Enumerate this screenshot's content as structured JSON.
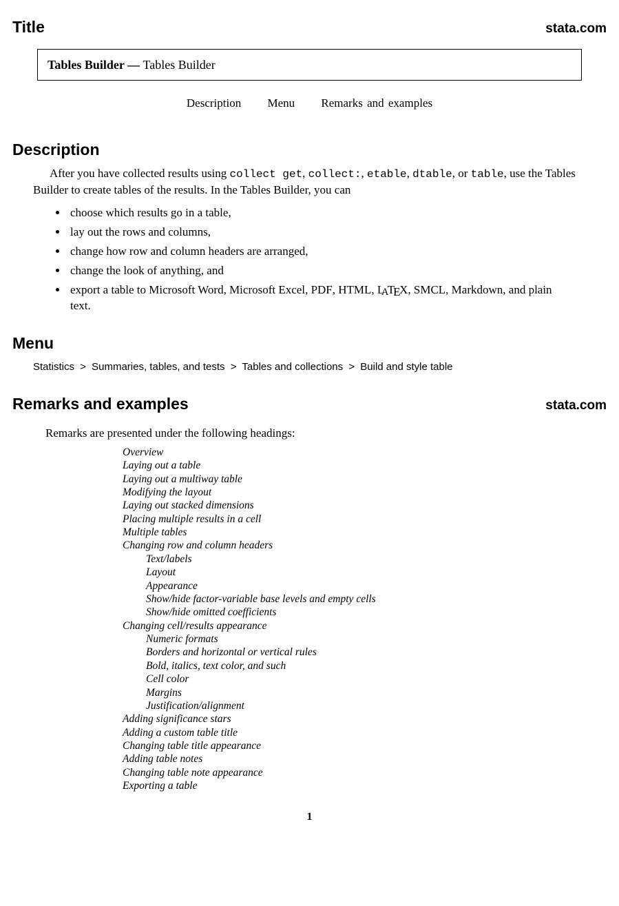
{
  "brand": "stata.com",
  "sections": {
    "title": "Title",
    "description": "Description",
    "menu": "Menu",
    "remarks": "Remarks and examples"
  },
  "title_box": {
    "name": "Tables Builder",
    "dash": " — ",
    "desc": "Tables Builder"
  },
  "nav": {
    "a": "Description",
    "b": "Menu",
    "c": "Remarks and examples"
  },
  "desc_para": {
    "pre": "After you have collected results using ",
    "cmds": [
      "collect get",
      "collect:",
      "etable",
      "dtable",
      "table"
    ],
    "post": ", use the Tables Builder to create tables of the results. In the Tables Builder, you can"
  },
  "bullets": {
    "b1": "choose which results go in a table,",
    "b2": "lay out the rows and columns,",
    "b3": "change how row and column headers are arranged,",
    "b4": "change the look of anything, and",
    "b5_pre": "export a table to Microsoft Word, Microsoft Excel, ",
    "b5_pdf": "PDF",
    "b5_s1": ", ",
    "b5_html": "HTML",
    "b5_s2": ", ",
    "b5_latex": "LATEX",
    "b5_s3": ", ",
    "b5_smcl": "SMCL",
    "b5_post": ", Markdown, and plain text."
  },
  "menu_path": {
    "a": "Statistics",
    "b": "Summaries, tables, and tests",
    "c": "Tables and collections",
    "d": "Build and style table",
    "sep": ">"
  },
  "remarks_intro": "Remarks are presented under the following headings:",
  "toc": {
    "i1": "Overview",
    "i2": "Laying out a table",
    "i3": "Laying out a multiway table",
    "i4": "Modifying the layout",
    "i5": "Laying out stacked dimensions",
    "i6": "Placing multiple results in a cell",
    "i7": "Multiple tables",
    "i8": "Changing row and column headers",
    "i8a": "Text/labels",
    "i8b": "Layout",
    "i8c": "Appearance",
    "i8d": "Show/hide factor-variable base levels and empty cells",
    "i8e": "Show/hide omitted coefficients",
    "i9": "Changing cell/results appearance",
    "i9a": "Numeric formats",
    "i9b": "Borders and horizontal or vertical rules",
    "i9c": "Bold, italics, text color, and such",
    "i9d": "Cell color",
    "i9e": "Margins",
    "i9f": "Justification/alignment",
    "i10": "Adding significance stars",
    "i11": "Adding a custom table title",
    "i12": "Changing table title appearance",
    "i13": "Adding table notes",
    "i14": "Changing table note appearance",
    "i15": "Exporting a table"
  },
  "page": "1"
}
